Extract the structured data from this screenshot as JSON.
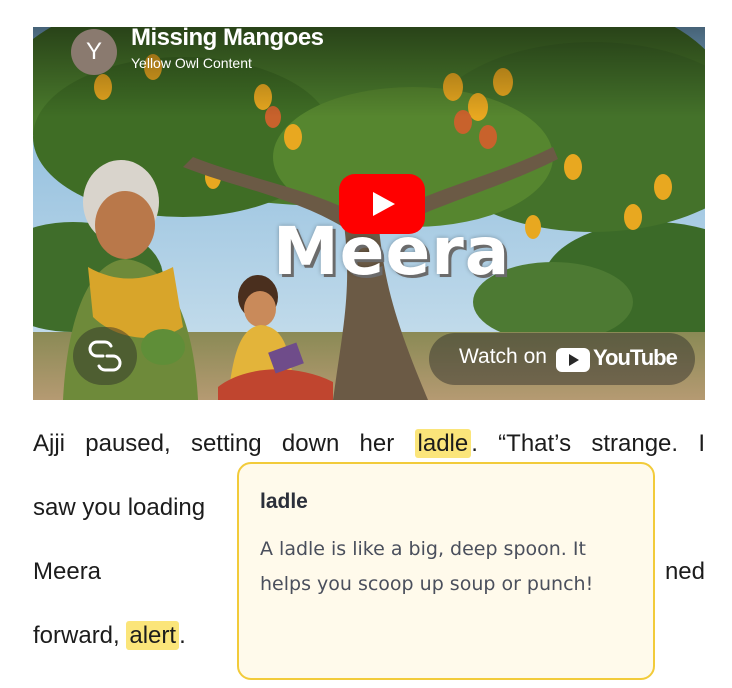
{
  "video": {
    "title": "Missing Mangoes",
    "channel": "Yellow Owl Content",
    "channel_avatar_letter": "Y",
    "overlay_title": "Meera",
    "watch_on_label": "Watch on",
    "youtube_wordmark": "YouTube",
    "icons": {
      "play": "play-icon",
      "copy_link": "link-icon",
      "youtube_logo": "youtube-logo-icon"
    }
  },
  "story": {
    "line1": {
      "before": "Ajji paused, setting down her",
      "word": "ladle",
      "after": ". “That’s strange. I"
    },
    "line2": {
      "text": "saw you loading"
    },
    "line3": {
      "left": "Meera looked u",
      "right": "ned"
    },
    "line4": {
      "before": "forward,",
      "word": "alert",
      "after": "."
    }
  },
  "tooltip": {
    "word": "ladle",
    "definition": "A ladle is like a big, deep spoon. It helps you scoop up soup or punch!"
  },
  "colors": {
    "highlight": "#fbe57a",
    "tooltip_background": "#fffaeb",
    "tooltip_border": "#f2cb3a",
    "youtube_red": "#ff0000"
  }
}
